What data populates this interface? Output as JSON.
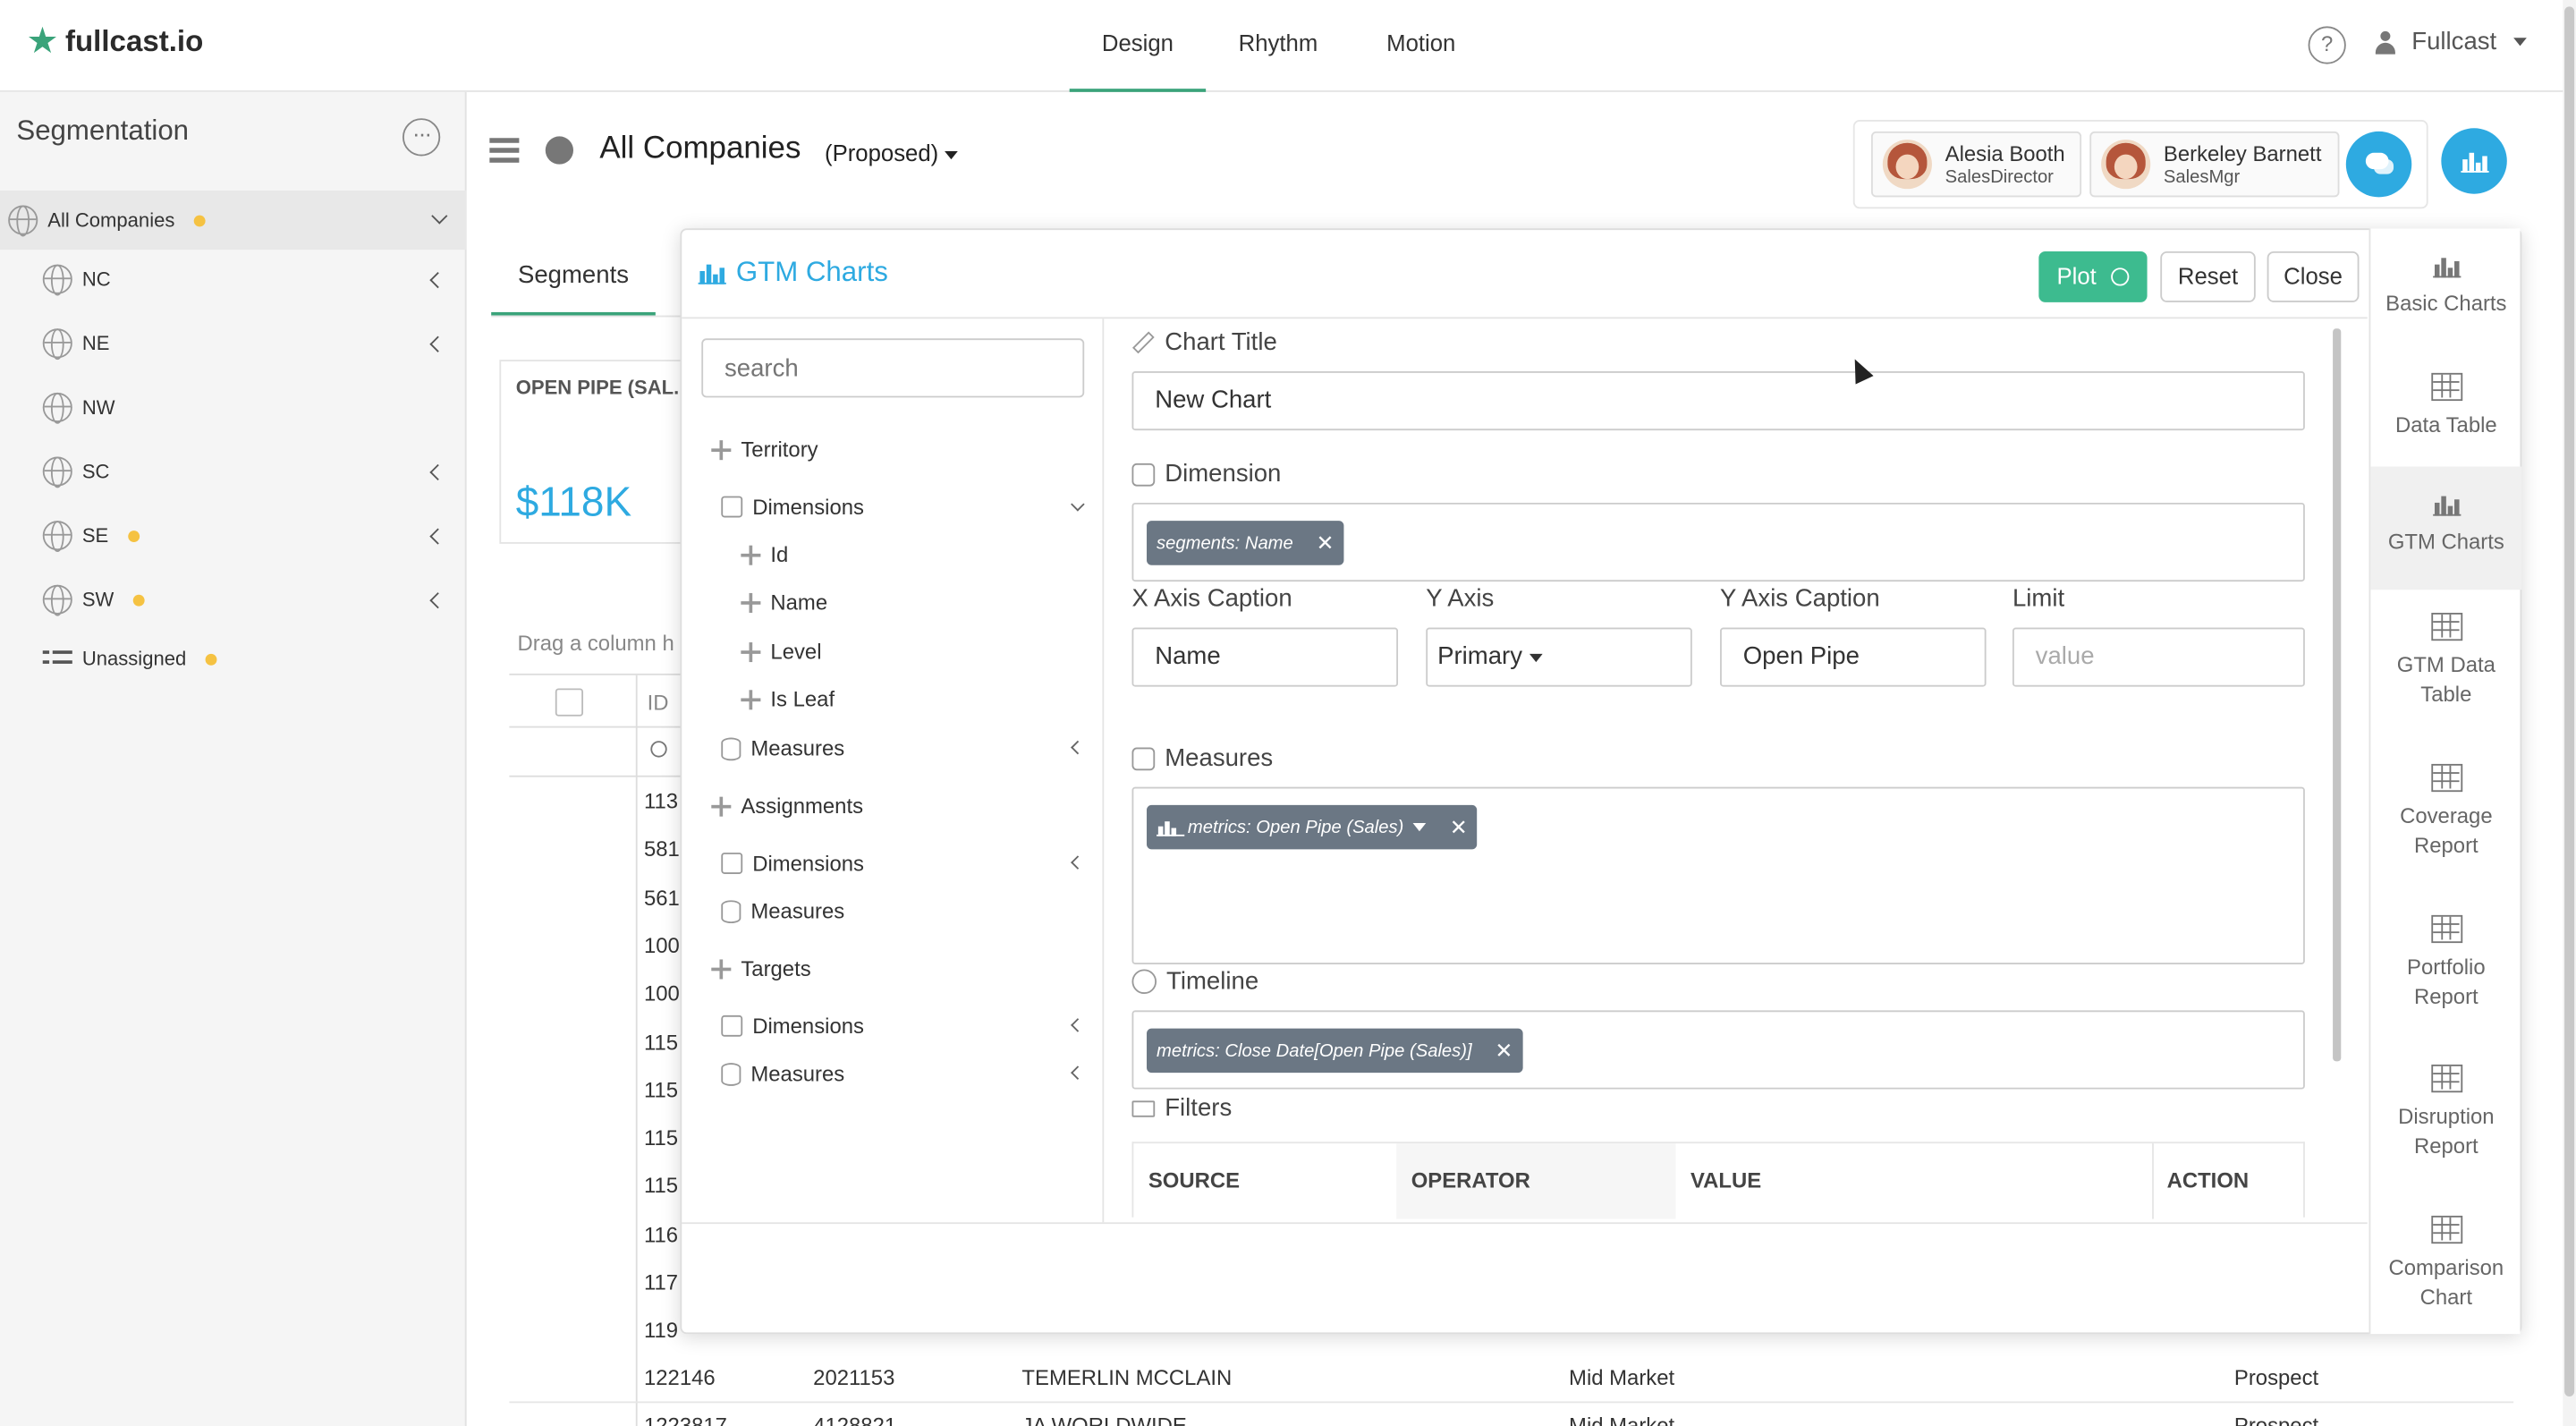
{
  "brand": {
    "name": "fullcast.io",
    "accent": "#3aa37a",
    "blue": "#2eaae1"
  },
  "nav": {
    "tabs": [
      "Design",
      "Rhythm",
      "Motion"
    ],
    "active": "Design"
  },
  "user": {
    "name": "Fullcast",
    "help": "?"
  },
  "sidebar": {
    "title": "Segmentation",
    "more": "···",
    "items": [
      {
        "label": "All Companies",
        "dot": true
      },
      {
        "label": "NC"
      },
      {
        "label": "NE"
      },
      {
        "label": "NW"
      },
      {
        "label": "SC"
      },
      {
        "label": "SE",
        "dot": true
      },
      {
        "label": "SW",
        "dot": true
      },
      {
        "label": "Unassigned",
        "dot": true
      }
    ]
  },
  "header": {
    "title": "All Companies",
    "status": "(Proposed)",
    "collaborators": [
      {
        "name": "Alesia Booth",
        "role": "SalesDirector"
      },
      {
        "name": "Berkeley Barnett",
        "role": "SalesMgr"
      }
    ]
  },
  "background": {
    "tab": "Segments",
    "kpi": {
      "label": "OPEN PIPE (SAL...",
      "value": "$118K"
    },
    "drag_hint": "Drag a column h",
    "id_header": "ID",
    "ids": [
      "113",
      "581",
      "561",
      "100",
      "100",
      "115",
      "115",
      "115",
      "115",
      "116",
      "117",
      "119"
    ],
    "rows": [
      {
        "id": "122146",
        "num": "2021153",
        "name": "TEMERLIN MCCLAIN",
        "segment": "Mid Market",
        "stage": "Prospect"
      },
      {
        "id": "1223817",
        "num": "4128821",
        "name": "JA WORLDWIDE",
        "segment": "Mid Market",
        "stage": "Prospect"
      }
    ]
  },
  "modal": {
    "title": "GTM Charts",
    "buttons": {
      "plot": "Plot",
      "reset": "Reset",
      "close": "Close"
    },
    "search_placeholder": "search",
    "tree": [
      {
        "label": "Territory",
        "kind": "group"
      },
      {
        "label": "Dimensions",
        "kind": "folder",
        "expanded": true
      },
      {
        "label": "Id",
        "kind": "field"
      },
      {
        "label": "Name",
        "kind": "field"
      },
      {
        "label": "Level",
        "kind": "field"
      },
      {
        "label": "Is Leaf",
        "kind": "field"
      },
      {
        "label": "Measures",
        "kind": "measures",
        "collapsed": true
      },
      {
        "label": "Assignments",
        "kind": "group"
      },
      {
        "label": "Dimensions",
        "kind": "folder",
        "collapsed": true
      },
      {
        "label": "Measures",
        "kind": "measures"
      },
      {
        "label": "Targets",
        "kind": "group"
      },
      {
        "label": "Dimensions",
        "kind": "folder",
        "collapsed": true
      },
      {
        "label": "Measures",
        "kind": "measures",
        "collapsed": true
      }
    ],
    "config": {
      "chart_title_label": "Chart Title",
      "chart_title_value": "New Chart",
      "dimension_label": "Dimension",
      "dimension_chip": "segments: Name",
      "x_caption_label": "X Axis Caption",
      "x_caption_value": "Name",
      "y_axis_label": "Y Axis",
      "y_axis_value": "Primary",
      "y_caption_label": "Y Axis Caption",
      "y_caption_value": "Open Pipe",
      "limit_label": "Limit",
      "limit_placeholder": "value",
      "measures_label": "Measures",
      "measures_chip": "metrics: Open Pipe (Sales)",
      "timeline_label": "Timeline",
      "timeline_chip": "metrics: Close Date[Open Pipe (Sales)]",
      "filters_label": "Filters",
      "filter_columns": [
        "SOURCE",
        "OPERATOR",
        "VALUE",
        "ACTION"
      ]
    }
  },
  "rail": [
    {
      "label": "Basic Charts",
      "icon": "bar-chart-icon"
    },
    {
      "label": "Data Table",
      "icon": "table-icon"
    },
    {
      "label": "GTM Charts",
      "icon": "bar-chart-icon",
      "active": true
    },
    {
      "label": "GTM Data Table",
      "icon": "table-icon"
    },
    {
      "label": "Coverage Report",
      "icon": "table-icon"
    },
    {
      "label": "Portfolio Report",
      "icon": "table-icon"
    },
    {
      "label": "Disruption Report",
      "icon": "table-icon"
    },
    {
      "label": "Comparison Chart",
      "icon": "table-icon"
    }
  ]
}
